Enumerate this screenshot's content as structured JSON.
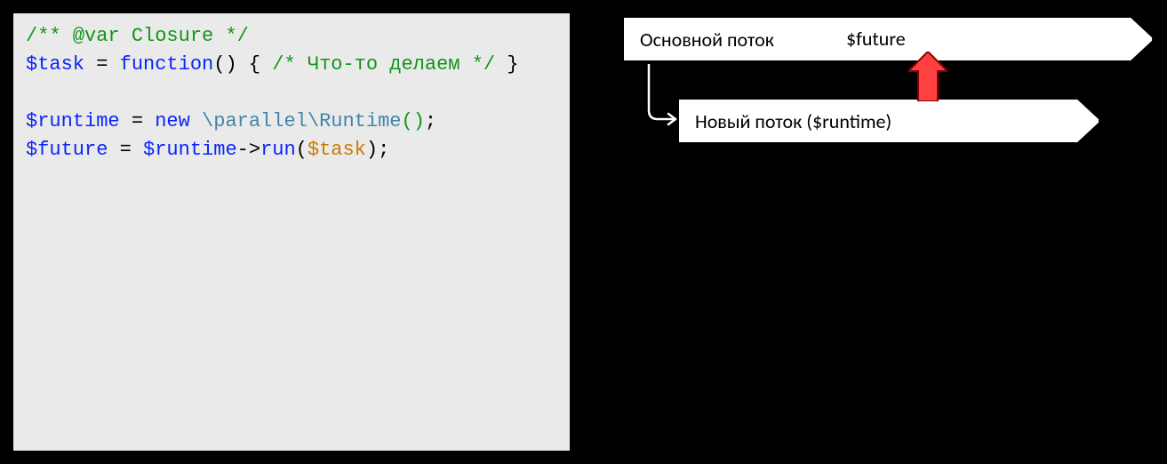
{
  "code": {
    "l1_comment": "/** @var Closure */",
    "l2_var": "$task",
    "l2_assign": " = ",
    "l2_fn_kw": "function",
    "l2_paren": "()",
    "l2_brace_open": " { ",
    "l2_inner_comment": "/* Что-то делаем */",
    "l2_brace_close": " }",
    "l4_var": "$runtime",
    "l4_assign": " = ",
    "l4_new": "new ",
    "l4_ns_p1": "\\parallel",
    "l4_ns_p2": "\\Runtime",
    "l4_call": "()",
    "l4_semi": ";",
    "l5_var": "$future",
    "l5_assign": " = ",
    "l5_obj": "$runtime",
    "l5_arrow": "->",
    "l5_method": "run",
    "l5_paren_open": "(",
    "l5_arg": "$task",
    "l5_paren_close": ")",
    "l5_semi": ";"
  },
  "diagram": {
    "main_flow_label": "Основной поток",
    "future_label": "$future",
    "sub_flow_label": "Новый поток ($runtime)"
  },
  "colors": {
    "red_arrow_fill": "#ff4040",
    "red_arrow_stroke": "#8b0000"
  }
}
